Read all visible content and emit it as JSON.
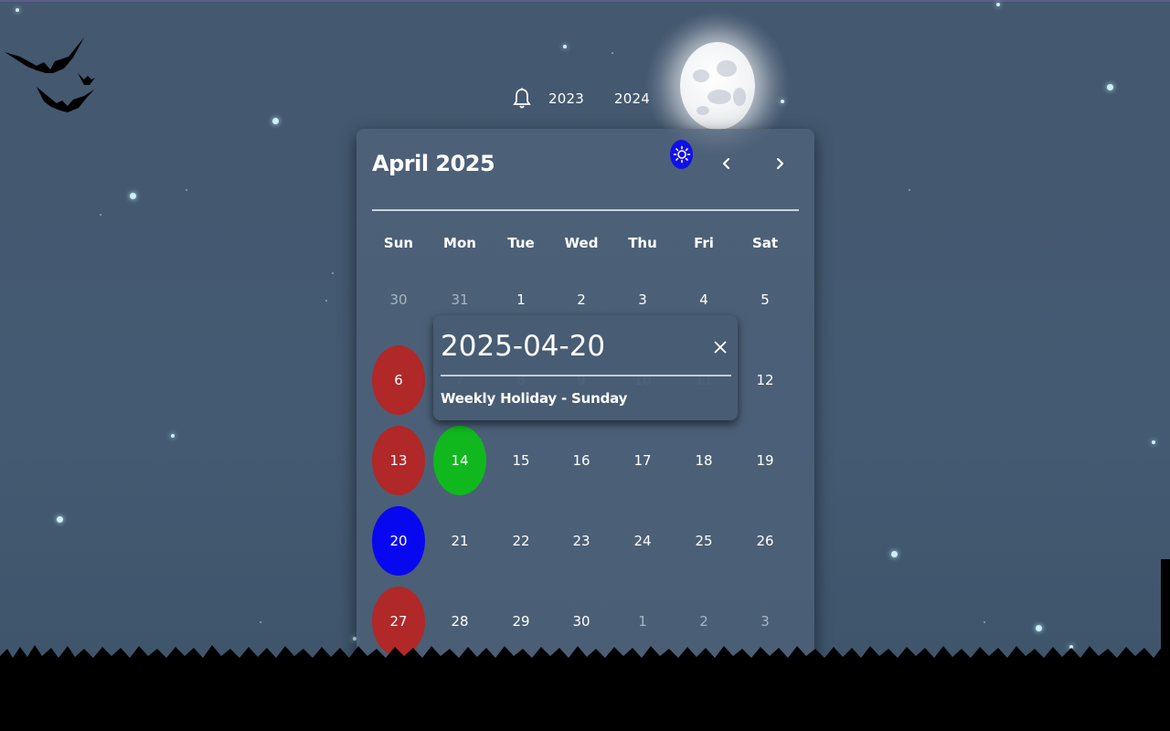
{
  "nav": {
    "bell_icon": "bell-icon",
    "years": [
      "2023",
      "2024"
    ]
  },
  "calendar": {
    "title": "April 2025",
    "theme_icon": "sun-icon",
    "prev_icon": "chevron-left-icon",
    "next_icon": "chevron-right-icon",
    "weekdays": [
      "Sun",
      "Mon",
      "Tue",
      "Wed",
      "Thu",
      "Fri",
      "Sat"
    ],
    "days": [
      [
        "30",
        "31",
        "1",
        "2",
        "3",
        "4",
        "5"
      ],
      [
        "6",
        "7",
        "8",
        "9",
        "10",
        "11",
        "12"
      ],
      [
        "13",
        "14",
        "15",
        "16",
        "17",
        "18",
        "19"
      ],
      [
        "20",
        "21",
        "22",
        "23",
        "24",
        "25",
        "26"
      ],
      [
        "27",
        "28",
        "29",
        "30",
        "1",
        "2",
        "3"
      ]
    ],
    "colors": {
      "holiday": "#b02828",
      "today": "#10b81e",
      "selected": "#0808f0",
      "theme_button": "#1010e8"
    }
  },
  "popup": {
    "date": "2025-04-20",
    "description": "Weekly Holiday - Sunday",
    "close_icon": "close-icon"
  }
}
